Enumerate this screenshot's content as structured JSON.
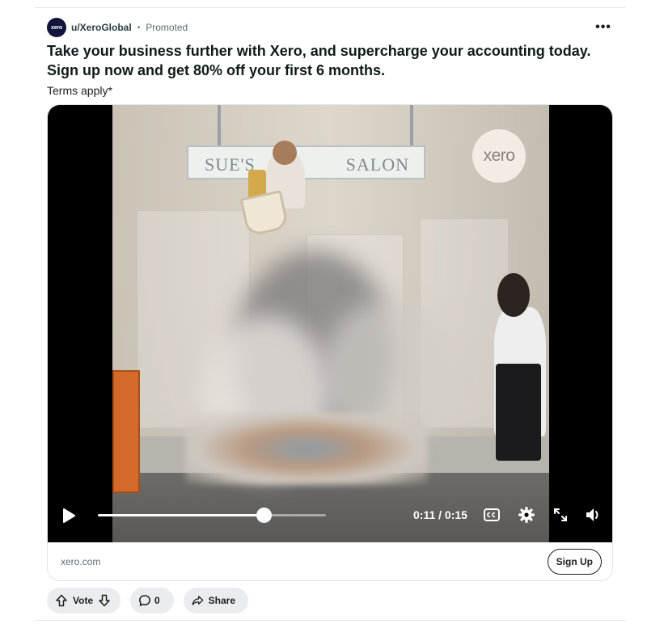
{
  "post": {
    "avatar_text": "xero",
    "username": "u/XeroGlobal",
    "separator": "•",
    "promoted_label": "Promoted",
    "more_label": "•••",
    "title": "Take your business further with Xero, and supercharge your accounting today. Sign up now and get 80% off your first 6 months.",
    "terms": "Terms apply*"
  },
  "video": {
    "sign_left": "SUE'S",
    "sign_right": "SALON",
    "logo_text": "xero",
    "time": "0:11 / 0:15",
    "progress": 0.73,
    "icons": [
      "play-icon",
      "closed-captions-icon",
      "settings-gear-icon",
      "expand-icon",
      "volume-icon"
    ]
  },
  "footer": {
    "domain": "xero.com",
    "cta_label": "Sign Up"
  },
  "actions": {
    "vote_label": "Vote",
    "comment_count": "0",
    "share_label": "Share"
  }
}
